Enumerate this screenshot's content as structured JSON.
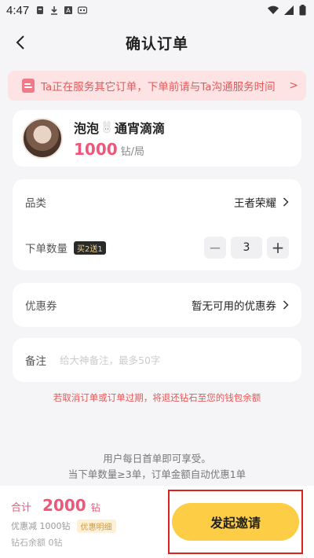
{
  "status_bar": {
    "time": "4:47"
  },
  "nav": {
    "title": "确认订单"
  },
  "notice": {
    "text": "Ta正在服务其它订单，下单前请与Ta沟通服务时间",
    "arrow": ">"
  },
  "profile": {
    "name_a": "泡泡",
    "name_b": "通宵滴滴",
    "price": "1000",
    "price_unit": "钻/局"
  },
  "order": {
    "category_label": "品类",
    "category_value": "王者荣耀",
    "quantity_label": "下单数量",
    "promo_badge": "买2送1",
    "quantity_value": "3",
    "minus": "−",
    "plus": "+"
  },
  "coupon": {
    "label": "优惠券",
    "value": "暂无可用的优惠券"
  },
  "remark": {
    "label": "备注",
    "placeholder": "给大神备注，最多50字"
  },
  "refund_tip": "若取消订单或订单过期，将退还钻石至您的钱包余额",
  "tips": {
    "line1": "用户每日首单即可享受。",
    "line2": "当下单数量≥3单，订单金额自动优惠1单"
  },
  "footer": {
    "total_label": "合计",
    "total_value": "2000",
    "total_unit": "钻",
    "discount_text": "优惠减 1000钻",
    "detail_label": "优惠明细",
    "balance_text": "钻石余额 0钻",
    "submit_label": "发起邀请"
  },
  "colors": {
    "accent_pink": "#f0557a",
    "button_yellow": "#fccd45",
    "notice_bg": "#fde3e3",
    "highlight_red": "#e02020"
  }
}
